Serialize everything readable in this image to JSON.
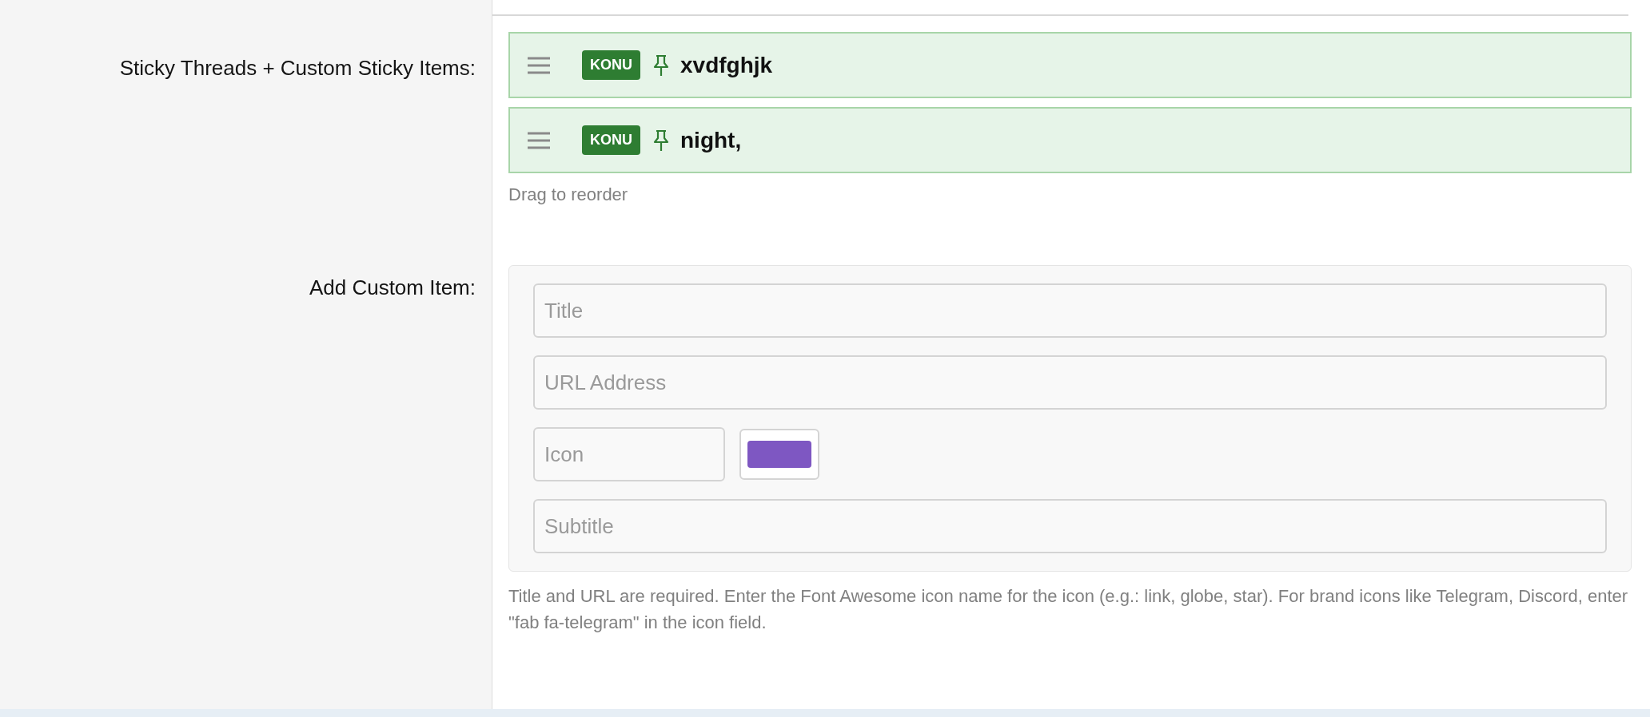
{
  "sticky_section": {
    "label": "Sticky Threads + Custom Sticky Items:",
    "items": [
      {
        "badge": "KONU",
        "title": "xvdfghjk"
      },
      {
        "badge": "KONU",
        "title": "night,"
      }
    ],
    "hint": "Drag to reorder"
  },
  "custom_item_section": {
    "label": "Add Custom Item:",
    "fields": {
      "title": {
        "placeholder": "Title"
      },
      "url": {
        "placeholder": "URL Address"
      },
      "icon": {
        "placeholder": "Icon"
      },
      "color": {
        "color": "#7e57c2"
      },
      "subtitle": {
        "placeholder": "Subtitle"
      }
    },
    "hint": "Title and URL are required. Enter the Font Awesome icon name for the icon (e.g.: link, globe, star). For brand icons like Telegram, Discord, enter \"fab fa-telegram\" in the icon field."
  }
}
